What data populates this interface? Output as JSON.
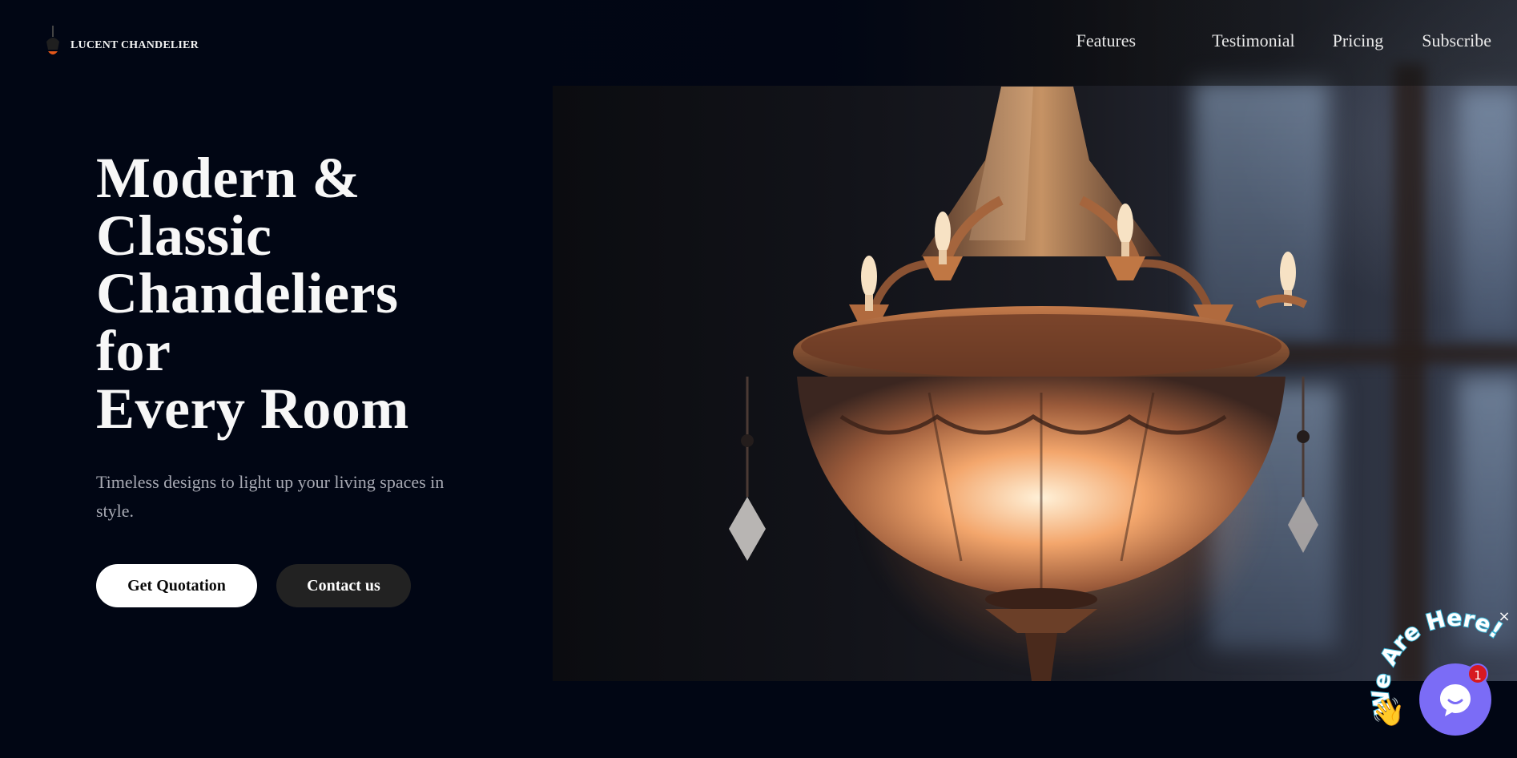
{
  "brand": {
    "name": "LUCENT CHANDELIER"
  },
  "nav": {
    "items": [
      "Features",
      "Testimonial",
      "Pricing",
      "Subscribe"
    ]
  },
  "hero": {
    "headline_lines": [
      "Modern &",
      "Classic",
      "Chandeliers",
      "for",
      "Every Room"
    ],
    "subtitle": "Timeless designs to light up your living spaces in style.",
    "primary_button": "Get Quotation",
    "secondary_button": "Contact us"
  },
  "chat": {
    "arc_text": "We Are Here!",
    "badge_count": "1",
    "close_label": "×",
    "icon": "chat-bubble-icon"
  },
  "colors": {
    "background": "#010614",
    "chat_accent": "#7b6cf6",
    "badge": "#d71920",
    "primary_button": "#ffffff",
    "secondary_button": "#222222"
  }
}
